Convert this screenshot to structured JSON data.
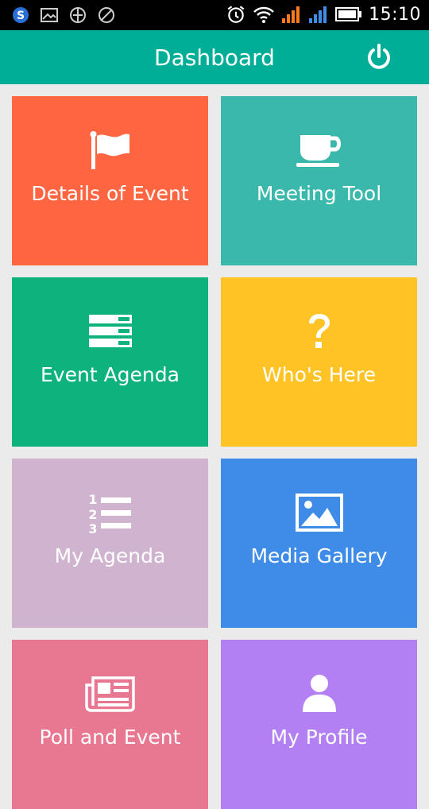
{
  "status_bar": {
    "time": "15:10",
    "left_icons": [
      "skype-icon",
      "image-icon",
      "globe-icon",
      "blocked-icon"
    ],
    "right_icons": [
      "alarm-icon",
      "wifi-icon",
      "signal-orange-icon",
      "signal-blue-icon",
      "battery-icon"
    ]
  },
  "app_bar": {
    "title": "Dashboard",
    "action_icon": "power-icon",
    "color": "#00ae97"
  },
  "tiles": [
    {
      "label": "Details of Event",
      "icon": "flag-icon",
      "color": "#ff6541"
    },
    {
      "label": "Meeting Tool",
      "icon": "coffee-cup-icon",
      "color": "#39b8ab"
    },
    {
      "label": "Event Agenda",
      "icon": "server-list-icon",
      "color": "#0db27c"
    },
    {
      "label": "Who's Here",
      "icon": "question-mark-icon",
      "color": "#ffc325"
    },
    {
      "label": "My Agenda",
      "icon": "numbered-list-icon",
      "color": "#cfb3cf"
    },
    {
      "label": "Media Gallery",
      "icon": "image-icon",
      "color": "#3f8ce8"
    },
    {
      "label": "Poll and Event",
      "icon": "newspaper-icon",
      "color": "#e87791"
    },
    {
      "label": "My Profile",
      "icon": "user-icon",
      "color": "#b280f3"
    }
  ]
}
